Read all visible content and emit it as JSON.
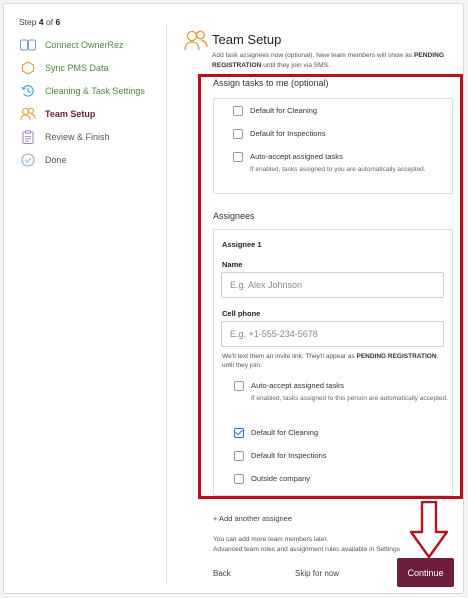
{
  "wizard": {
    "step_prefix": "Step",
    "step_current": "4",
    "step_of": "of",
    "step_total": "6"
  },
  "sidebar": {
    "items": [
      {
        "label": "Connect OwnerRez",
        "icon": "link-card-icon",
        "state": "done"
      },
      {
        "label": "Sync PMS Data",
        "icon": "sync-hexagon-icon",
        "state": "done"
      },
      {
        "label": "Cleaning & Task Settings",
        "icon": "clock-history-icon",
        "state": "done"
      },
      {
        "label": "Team Setup",
        "icon": "team-icon",
        "state": "active"
      },
      {
        "label": "Review & Finish",
        "icon": "clipboard-icon",
        "state": "pending"
      },
      {
        "label": "Done",
        "icon": "check-circle-icon",
        "state": "pending"
      }
    ]
  },
  "main": {
    "title": "Team Setup",
    "icon": "team-icon",
    "description_pre": "Add task assignees now (optional). New team members will show as",
    "description_bold": "PENDING REGISTRATION",
    "description_post": "until they join via SMS."
  },
  "assign_to_me": {
    "title": "Assign tasks to me (optional)",
    "default_cleaning": {
      "label": "Default for Cleaning",
      "checked": false
    },
    "default_inspections": {
      "label": "Default for Inspections",
      "checked": false
    },
    "auto_accept": {
      "label": "Auto-accept assigned tasks",
      "help": "If enabled, tasks assigned to you are automatically accepted.",
      "checked": false
    }
  },
  "assignees": {
    "title": "Assignees",
    "items": [
      {
        "heading": "Assignee 1",
        "name_label": "Name",
        "name_value": "",
        "name_placeholder": "E.g. Alex Johnson",
        "phone_label": "Cell phone",
        "phone_value": "",
        "phone_placeholder": "E.g. +1-555-234-5678",
        "phone_note_pre": "We'll text them an invite link. They'll appear as",
        "phone_note_bold": "PENDING REGISTRATION",
        "phone_note_post": "until they join.",
        "auto_accept": {
          "label": "Auto-accept assigned tasks",
          "help": "If enabled, tasks assigned to this person are automatically accepted.",
          "checked": false
        },
        "default_cleaning": {
          "label": "Default for Cleaning",
          "checked": true
        },
        "default_inspections": {
          "label": "Default for Inspections",
          "checked": false
        },
        "outside_company": {
          "label": "Outside company",
          "checked": false
        }
      }
    ],
    "add_label": "+ Add another assignee"
  },
  "footer": {
    "note_line1": "You can add more team members later.",
    "note_line2": "Advanced team roles and assignment rules available in Settings",
    "back_label": "Back",
    "skip_label": "Skip for now",
    "continue_label": "Continue"
  },
  "colors": {
    "accent": "#6d1d3b",
    "done_green": "#4d8a3b",
    "highlight_red": "#b6121c",
    "checkbox_blue": "#2f6fc2",
    "icon_orange": "#e09a3c"
  }
}
